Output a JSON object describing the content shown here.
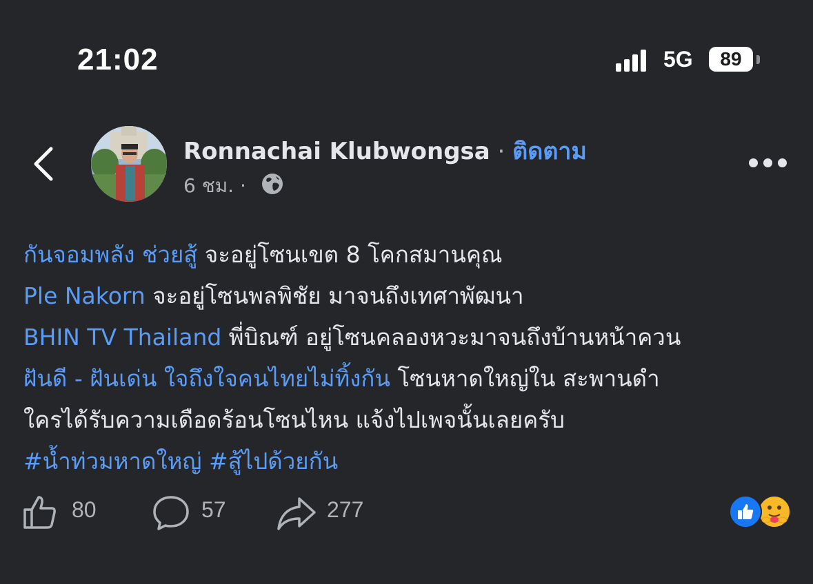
{
  "status_bar": {
    "time": "21:02",
    "network": "5G",
    "battery": "89"
  },
  "header": {
    "author_name": "Ronnachai Klubwongsa",
    "separator": " · ",
    "follow_label": "ติดตาม",
    "time_ago": "6 ชม.",
    "meta_separator": " ·",
    "privacy_icon": "globe-icon"
  },
  "post": {
    "lines": [
      [
        {
          "text": "กันจอมพลัง ช่วยสู้",
          "link": true
        },
        {
          "text": " จะอยู่โซนเขต 8 โคกสมานคุณ",
          "link": false
        }
      ],
      [
        {
          "text": "Ple Nakorn",
          "link": true
        },
        {
          "text": " จะอยู่โซนพลพิชัย มาจนถึงเทศาพัฒนา",
          "link": false
        }
      ],
      [
        {
          "text": "BHIN TV Thailand",
          "link": true
        },
        {
          "text": " พี่บิณฑ์ อยู่โซนคลองหวะมาจนถึงบ้านหน้าควน",
          "link": false
        }
      ],
      [
        {
          "text": "ฝันดี - ฝันเด่น ใจถึงใจคนไทยไม่ทิ้งกัน",
          "link": true
        },
        {
          "text": " โซนหาดใหญ่ใน สะพานดำ",
          "link": false
        }
      ],
      [
        {
          "text": "ใครได้รับความเดือดร้อนโซนไหน แจ้งไปเพจนั้นเลยครับ",
          "link": false
        }
      ],
      [
        {
          "text": "#น้ำท่วมหาดใหญ่ #สู้ไปด้วยกัน",
          "link": true
        }
      ]
    ]
  },
  "actions": {
    "likes": "80",
    "comments": "57",
    "shares": "277"
  },
  "reactions": [
    "like-reaction-icon",
    "care-reaction-icon"
  ],
  "colors": {
    "background": "#252629",
    "link": "#5a9cf6",
    "text": "#e4e6eb",
    "muted": "#b0b3b8"
  }
}
